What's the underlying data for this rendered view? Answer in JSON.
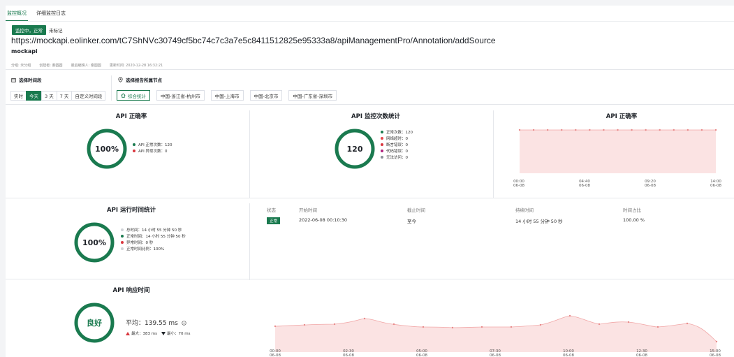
{
  "tabs": [
    {
      "label": "监控概况",
      "active": true
    },
    {
      "label": "详细监控日志",
      "active": false
    }
  ],
  "status_badge": "监控中，正常",
  "mark_label": "未标记",
  "api": {
    "url": "https://mockapi.eolinker.com/tC7ShNVc30749cf5bc74c7c3a7e5c8411512825e95333a8/apiManagementPro/Annotation/addSource",
    "name": "mockapi"
  },
  "meta": {
    "group": "分组: 未分组",
    "creator": "创建者: 秦圆圆",
    "editor": "最后编辑人: 秦圆圆",
    "updated": "更新时间: 2020-12-28 16:32:21"
  },
  "time_section": {
    "label": "选择时间段",
    "buttons": [
      {
        "label": "实时",
        "active": false
      },
      {
        "label": "今天",
        "active": true
      },
      {
        "label": "3 天",
        "active": false
      },
      {
        "label": "7 天",
        "active": false
      },
      {
        "label": "自定义时间段",
        "active": false
      }
    ]
  },
  "node_section": {
    "label": "选择报告所属节点",
    "buttons": [
      {
        "label": "综合统计",
        "active": true
      },
      {
        "label": "中国-浙江省-杭州市",
        "active": false
      },
      {
        "label": "中国-上海市",
        "active": false
      },
      {
        "label": "中国-北京市",
        "active": false
      },
      {
        "label": "中国-广东省-深圳市",
        "active": false
      }
    ]
  },
  "accuracy_card": {
    "title": "API 正确率",
    "value": "100%",
    "legend": [
      {
        "label": "API 正常次数：120",
        "color": "#1a7a4f"
      },
      {
        "label": "API 异常次数：0",
        "color": "#d9363e"
      }
    ]
  },
  "monitor_card": {
    "title": "API 监控次数统计",
    "value": "120",
    "legend": [
      {
        "label": "正常次数：120",
        "color": "#1a7a4f"
      },
      {
        "label": "网络超时：0",
        "color": "#e5484d"
      },
      {
        "label": "断言错误：0",
        "color": "#d9363e"
      },
      {
        "label": "代码错误：0",
        "color": "#b0227e"
      },
      {
        "label": "无法访问：0",
        "color": "#8a8f98"
      }
    ]
  },
  "accuracy_trend": {
    "title": "API 正确率",
    "ticks": [
      {
        "time": "00:00",
        "date": "06-08"
      },
      {
        "time": "04:40",
        "date": "06-08"
      },
      {
        "time": "09:20",
        "date": "06-08"
      },
      {
        "time": "14:00",
        "date": "06-08"
      }
    ]
  },
  "runtime_card": {
    "title": "API 运行时间统计",
    "value": "100%",
    "legend": [
      {
        "label": "总时间：14 小时 55 分钟 50 秒",
        "color": "#d0d3d8"
      },
      {
        "label": "正常时间：14 小时 55 分钟 50 秒",
        "color": "#1a7a4f"
      },
      {
        "label": "异常时间：0 秒",
        "color": "#d9363e"
      },
      {
        "label": "正常时间比例：100%",
        "color": "#d0d3d8"
      }
    ]
  },
  "runtime_table": {
    "headers": [
      "状态",
      "开始时间",
      "截止时间",
      "持续时间",
      "时间占比"
    ],
    "rows": [
      {
        "status": "正常",
        "start": "2022-06-08 00:10:30",
        "end": "至今",
        "duration": "14 小时 55 分钟 50 秒",
        "ratio": "100.00 %"
      }
    ]
  },
  "response_card": {
    "title": "API 响应时间",
    "grade": "良好",
    "avg_label": "平均：",
    "avg_value": "139.55 ms",
    "max_label": "最大：383 ms",
    "min_label": "最小：70 ms"
  },
  "response_trend": {
    "ticks": [
      {
        "time": "00:00",
        "date": "06-08"
      },
      {
        "time": "02:30",
        "date": "06-08"
      },
      {
        "time": "05:00",
        "date": "06-08"
      },
      {
        "time": "07:30",
        "date": "06-08"
      },
      {
        "time": "10:00",
        "date": "06-08"
      },
      {
        "time": "12:30",
        "date": "06-08"
      },
      {
        "time": "15:00",
        "date": "06-08"
      }
    ]
  },
  "colors": {
    "accent": "#1a7a4f",
    "error": "#d9363e",
    "chart_fill": "#fbe3e3",
    "chart_line": "#f1a7a7"
  }
}
